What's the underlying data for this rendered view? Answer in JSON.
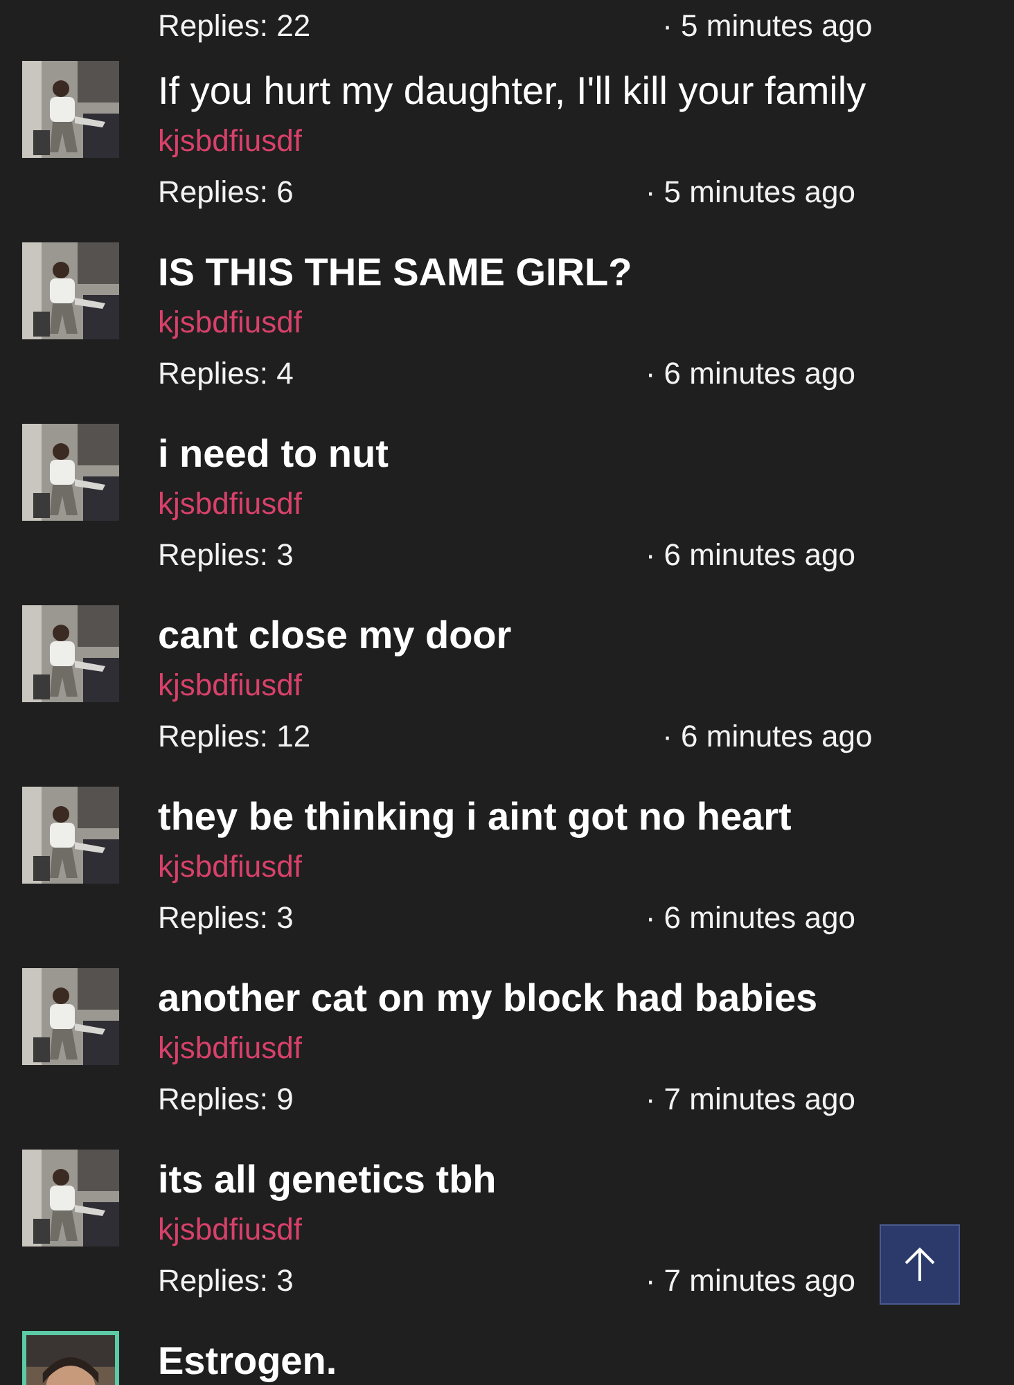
{
  "threads": [
    {
      "replies": "Replies: 22",
      "time": "· 5 minutes ago"
    },
    {
      "title": "If you hurt my daughter, I'll kill your family",
      "bold": false,
      "author": "kjsbdfiusdf",
      "replies": "Replies: 6",
      "time": "· 5 minutes ago",
      "avatar_framed": false
    },
    {
      "title": "IS THIS THE SAME GIRL?",
      "bold": true,
      "author": "kjsbdfiusdf",
      "replies": "Replies: 4",
      "time": "· 6 minutes ago",
      "avatar_framed": false
    },
    {
      "title": "i need to nut",
      "bold": true,
      "author": "kjsbdfiusdf",
      "replies": "Replies: 3",
      "time": "· 6 minutes ago",
      "avatar_framed": false
    },
    {
      "title": "cant close my door",
      "bold": true,
      "author": "kjsbdfiusdf",
      "replies": "Replies: 12",
      "time": "· 6 minutes ago",
      "avatar_framed": false
    },
    {
      "title": "they be thinking i aint got no heart",
      "bold": true,
      "author": "kjsbdfiusdf",
      "replies": "Replies: 3",
      "time": "· 6 minutes ago",
      "avatar_framed": false
    },
    {
      "title": "another cat on my block had babies",
      "bold": true,
      "author": "kjsbdfiusdf",
      "replies": "Replies: 9",
      "time": "· 7 minutes ago",
      "avatar_framed": false
    },
    {
      "title": "its all genetics tbh",
      "bold": true,
      "author": "kjsbdfiusdf",
      "replies": "Replies: 3",
      "time": "· 7 minutes ago",
      "avatar_framed": false
    },
    {
      "title": "Estrogen.",
      "bold": true,
      "avatar_framed": true
    }
  ]
}
